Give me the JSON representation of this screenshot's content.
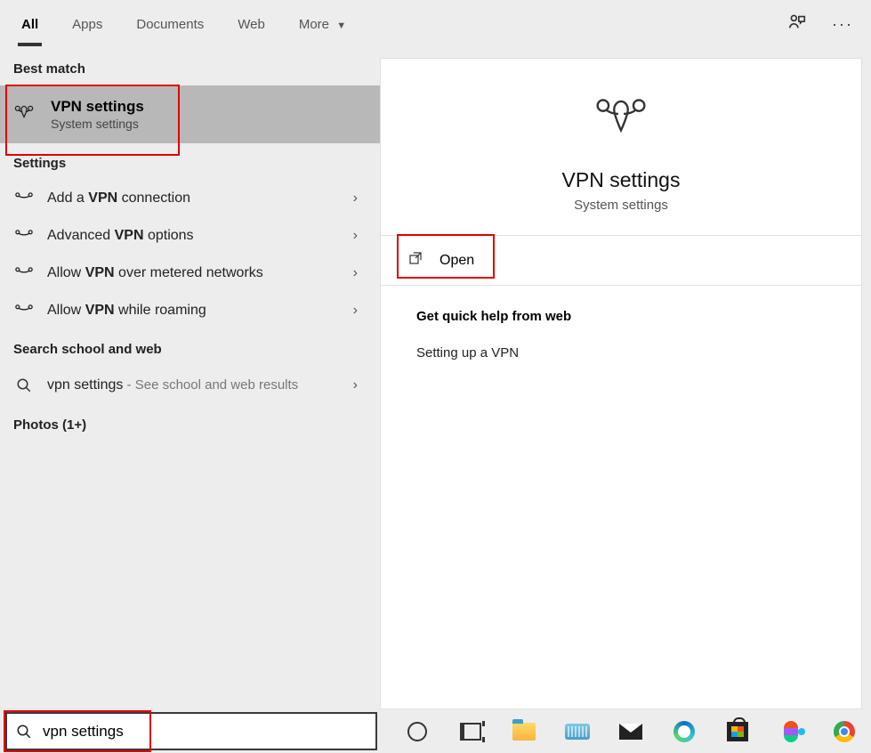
{
  "tabs": {
    "all": "All",
    "apps": "Apps",
    "documents": "Documents",
    "web": "Web",
    "more": "More"
  },
  "sections": {
    "best_match": "Best match",
    "settings": "Settings",
    "search_web": "Search school and web",
    "photos": "Photos (1+)"
  },
  "best_match": {
    "title": "VPN settings",
    "subtitle": "System settings"
  },
  "settings_items": [
    {
      "prefix": "Add a ",
      "bold": "VPN",
      "suffix": " connection"
    },
    {
      "prefix": "Advanced ",
      "bold": "VPN",
      "suffix": " options"
    },
    {
      "prefix": "Allow ",
      "bold": "VPN",
      "suffix": " over metered networks"
    },
    {
      "prefix": "Allow ",
      "bold": "VPN",
      "suffix": " while roaming"
    }
  ],
  "web_item": {
    "query": "vpn settings",
    "hint": " - See school and web results"
  },
  "preview": {
    "title": "VPN settings",
    "subtitle": "System settings",
    "open": "Open",
    "help_header": "Get quick help from web",
    "help_link": "Setting up a VPN"
  },
  "search": {
    "value": "vpn settings"
  }
}
